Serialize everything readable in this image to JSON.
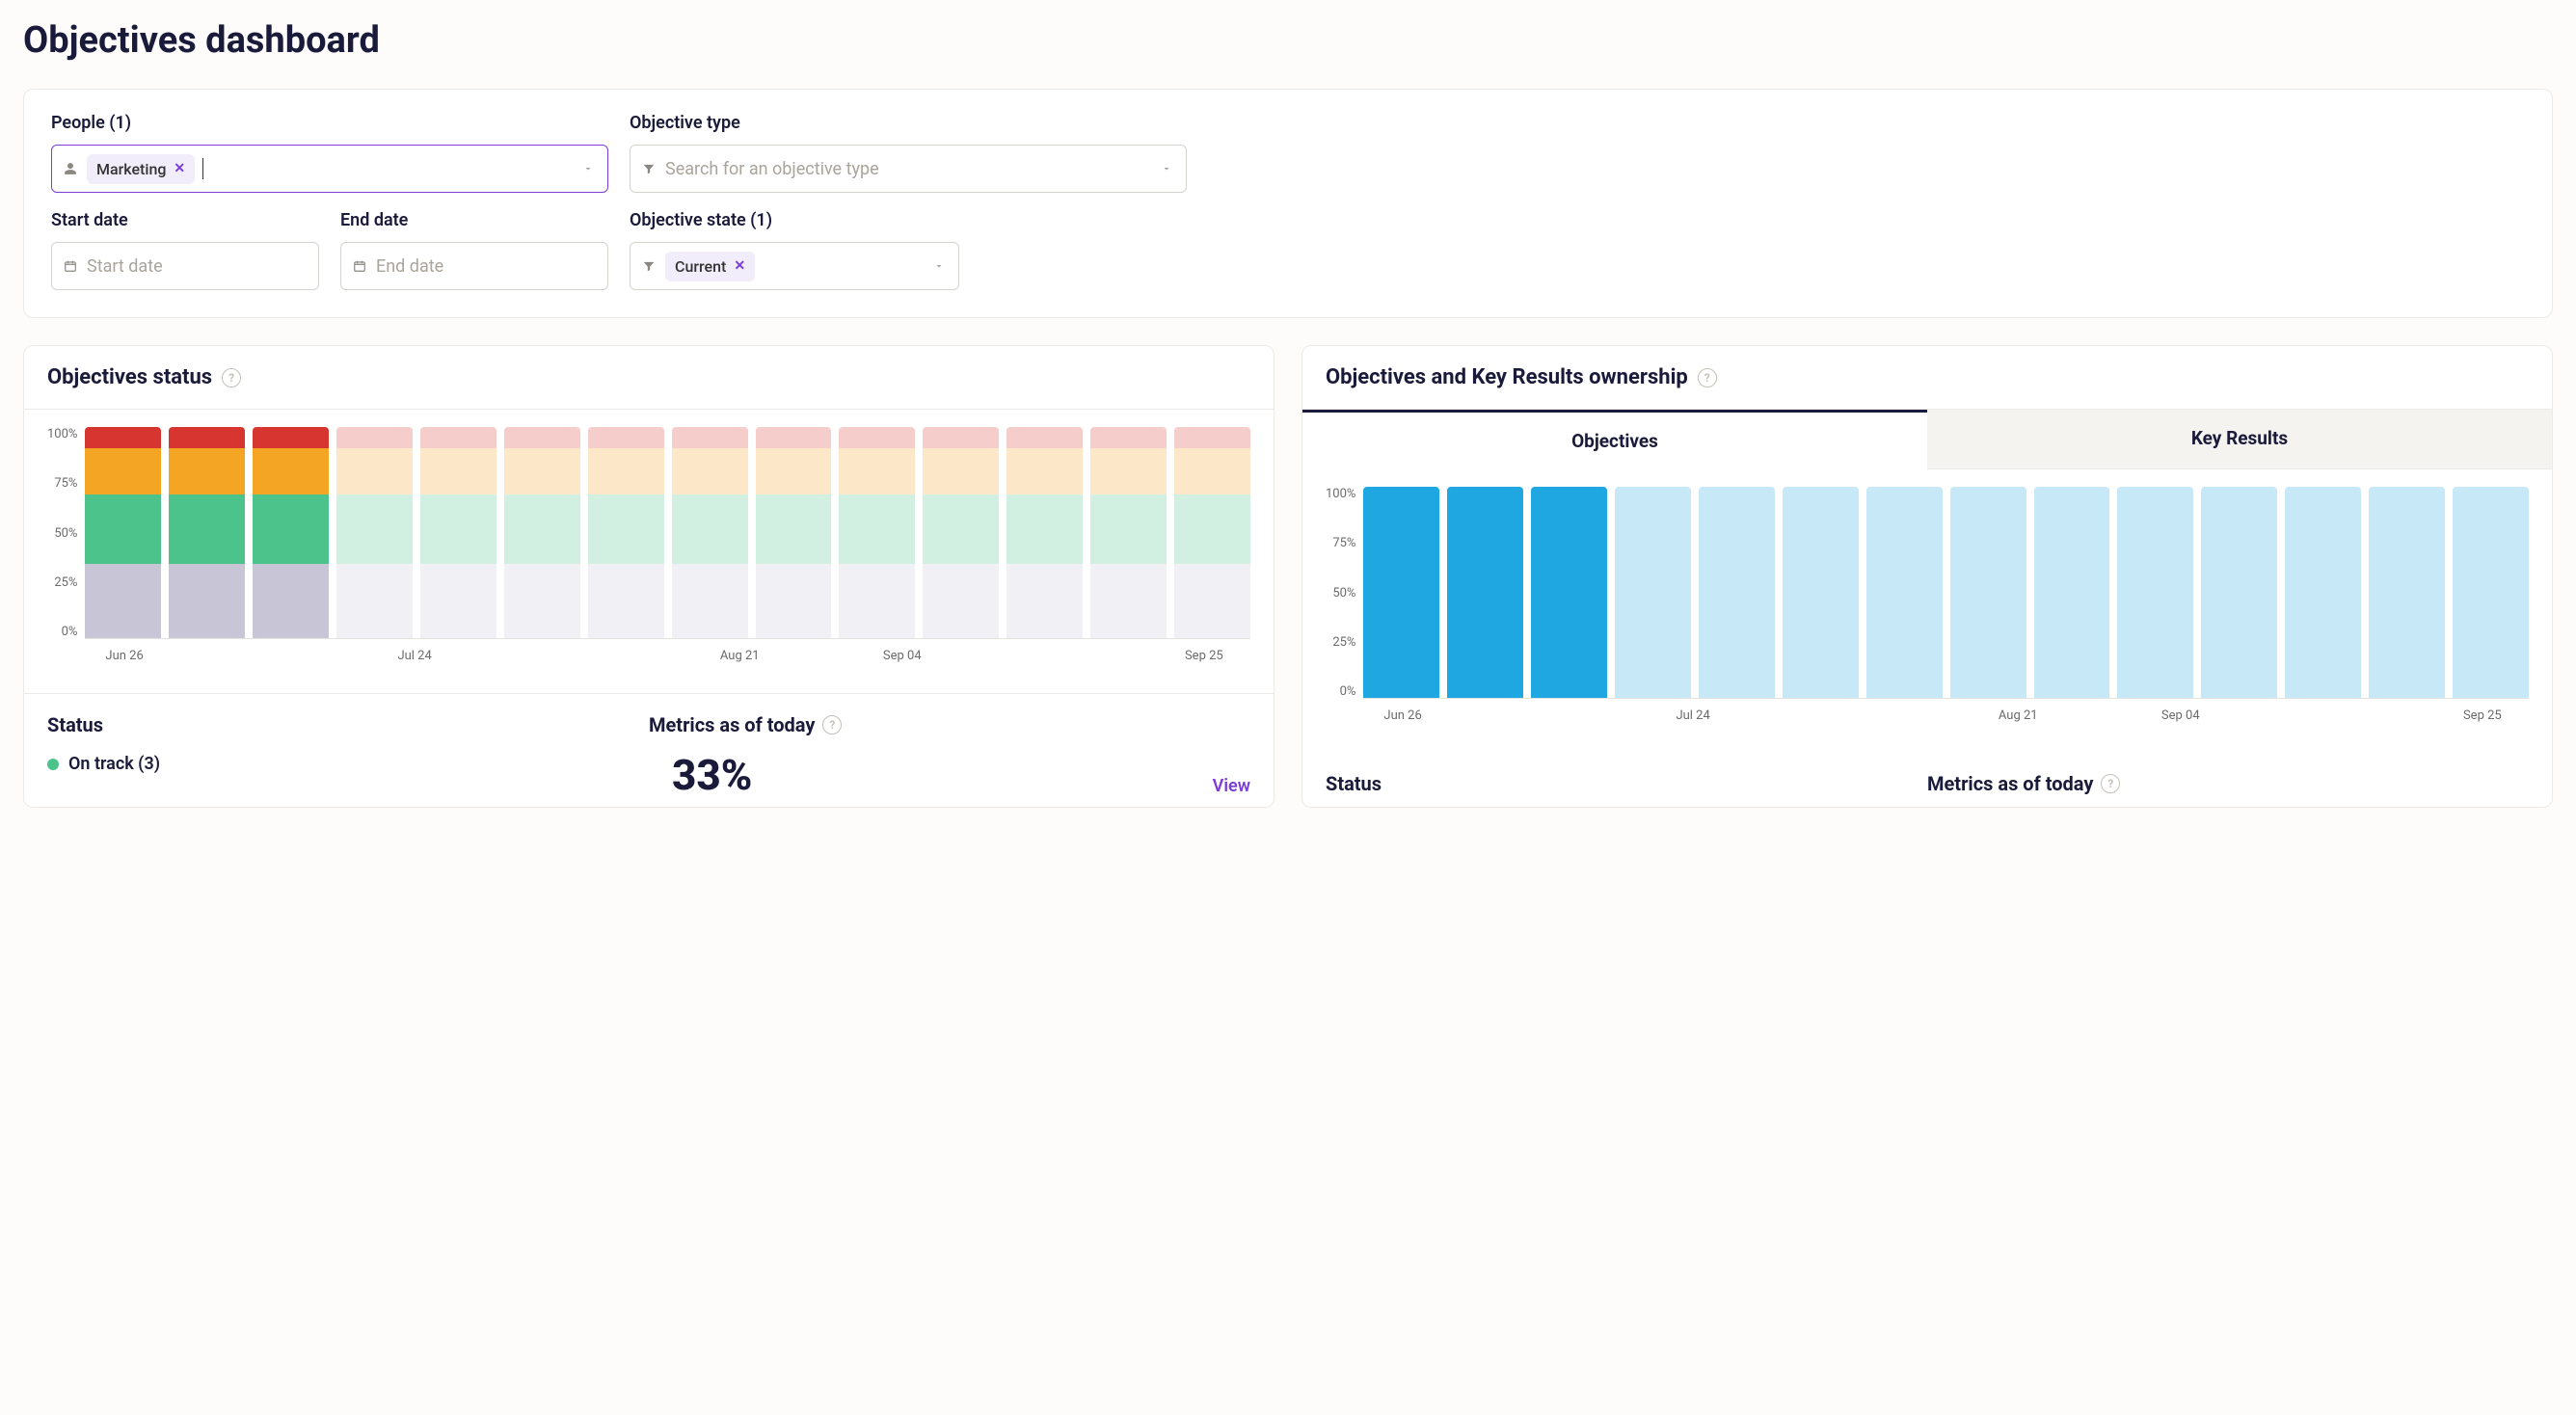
{
  "page_title": "Objectives dashboard",
  "filters": {
    "people": {
      "label": "People (1)",
      "chip": "Marketing"
    },
    "objective_type": {
      "label": "Objective type",
      "placeholder": "Search for an objective type"
    },
    "start_date": {
      "label": "Start date",
      "placeholder": "Start date"
    },
    "end_date": {
      "label": "End date",
      "placeholder": "End date"
    },
    "objective_state": {
      "label": "Objective state (1)",
      "chip": "Current"
    }
  },
  "panel_status": {
    "title": "Objectives status",
    "status_heading": "Status",
    "metrics_heading": "Metrics as of today",
    "legend_on_track": "On track (3)",
    "big_metric": "33%",
    "view_link": "View"
  },
  "panel_ownership": {
    "title": "Objectives and Key Results ownership",
    "tab_objectives": "Objectives",
    "tab_key_results": "Key Results",
    "status_heading": "Status",
    "metrics_heading": "Metrics as of today"
  },
  "chart_data": [
    {
      "type": "bar",
      "name": "Objectives status",
      "ylabel": "%",
      "ylim": [
        0,
        100
      ],
      "y_ticks": [
        "100%",
        "75%",
        "50%",
        "25%",
        "0%"
      ],
      "x_labels": [
        "Jun 26",
        "Jul 24",
        "Aug 21",
        "Sep 04",
        "Sep 25"
      ],
      "columns_count": 14,
      "active_columns": [
        0,
        1,
        2
      ],
      "colors": {
        "no_update": "#c7c5d6",
        "on_track": "#4cc38a",
        "progressing": "#f5a524",
        "off_track": "#d6362f"
      },
      "segments": [
        {
          "name": "no_update",
          "value": 35
        },
        {
          "name": "on_track",
          "value": 33
        },
        {
          "name": "progressing",
          "value": 22
        },
        {
          "name": "off_track",
          "value": 10
        }
      ]
    },
    {
      "type": "bar",
      "name": "Objectives and Key Results ownership",
      "ylabel": "%",
      "ylim": [
        0,
        100
      ],
      "y_ticks": [
        "100%",
        "75%",
        "50%",
        "25%",
        "0%"
      ],
      "x_labels": [
        "Jun 26",
        "Jul 24",
        "Aug 21",
        "Sep 04",
        "Sep 25"
      ],
      "columns_count": 14,
      "active_columns": [
        0,
        1,
        2
      ],
      "colors": {
        "owned": "#1ea7e0"
      },
      "segments": [
        {
          "name": "owned",
          "value": 100
        }
      ]
    }
  ]
}
